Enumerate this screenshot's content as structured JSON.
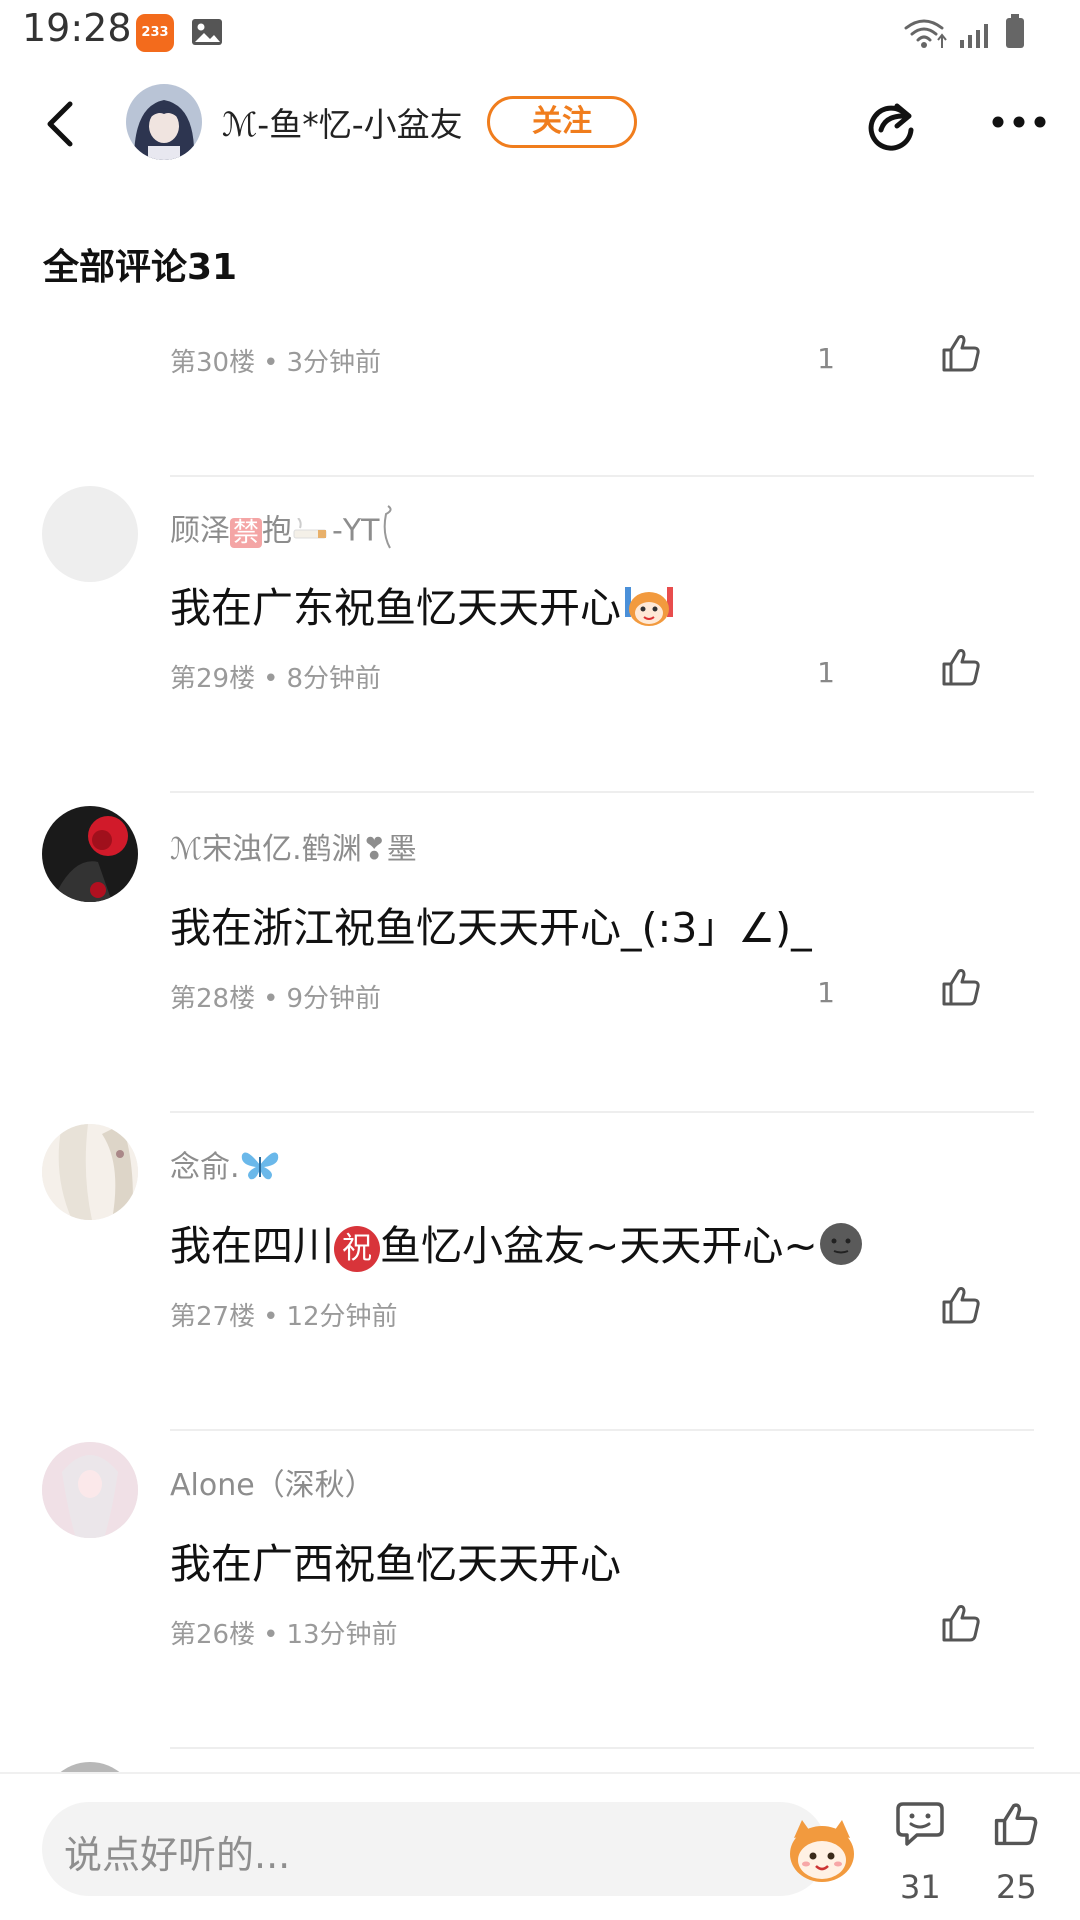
{
  "status_bar": {
    "time": "19:28",
    "badge": "233"
  },
  "header": {
    "username": "ℳ-鱼*忆-小盆友",
    "follow_label": "关注"
  },
  "section": {
    "title": "全部评论31"
  },
  "comments": [
    {
      "floor": "第30楼",
      "time": "3分钟前",
      "likes": "1"
    },
    {
      "user_prefix": "顾泽",
      "user_badge": "禁",
      "user_middle": "抱",
      "user_suffix": "-YT",
      "text": "我在广东祝鱼忆天天开心",
      "floor": "第29楼",
      "time": "8分钟前",
      "likes": "1"
    },
    {
      "user": "ℳ宋浊亿.鹤渊❣墨",
      "text": "我在浙江祝鱼忆天天开心_(:3」∠)_",
      "floor": "第28楼",
      "time": "9分钟前",
      "likes": "1"
    },
    {
      "user": "念俞.",
      "text_a": "我在四川",
      "text_badge": "祝",
      "text_b": "鱼忆小盆友~天天开心~",
      "floor": "第27楼",
      "time": "12分钟前",
      "likes": ""
    },
    {
      "user": "Alone（深秋）",
      "text": "我在广西祝鱼忆天天开心",
      "floor": "第26楼",
      "time": "13分钟前",
      "likes": ""
    }
  ],
  "bottom_bar": {
    "input_placeholder": "说点好听的...",
    "comment_count": "31",
    "like_count": "25"
  }
}
